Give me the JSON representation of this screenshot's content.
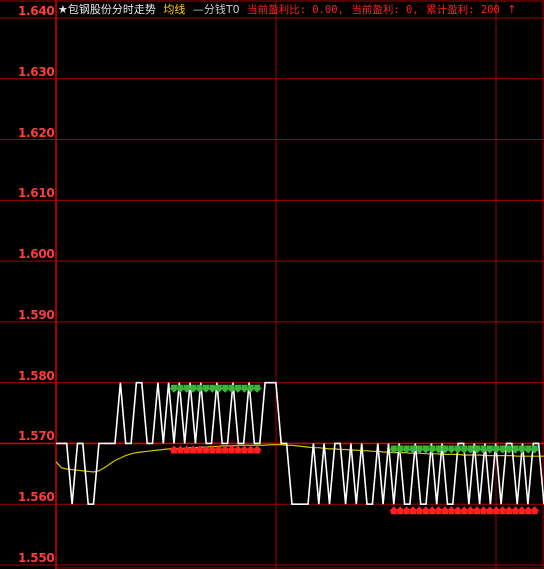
{
  "header": {
    "title": "★包钢股份分时走势",
    "avg_label": "均线",
    "minute_label": "—分钱T0",
    "profit_ratio_label": "当前盈利比",
    "profit_ratio_value": "0.00,",
    "current_profit_label": "当前盈利",
    "current_profit_value": "0,",
    "total_profit_label": "累计盈利",
    "total_profit_value": "200",
    "arrow": "↑"
  },
  "colors": {
    "background": "#000000",
    "grid": "#a00000",
    "axis_text": "#ff3c3c",
    "price_line": "#ffffff",
    "avg_line": "#d4c400",
    "buy_arrow": "#ff2020",
    "sell_arrow": "#3cb43c"
  },
  "chart_data": {
    "type": "line",
    "ylim": [
      1.55,
      1.64
    ],
    "yticks": [
      "1.640",
      "1.630",
      "1.620",
      "1.610",
      "1.600",
      "1.590",
      "1.580",
      "1.570",
      "1.560",
      "1.550"
    ],
    "series": [
      {
        "values": [
          1.57,
          1.57,
          1.57,
          1.56,
          1.57,
          1.57,
          1.56,
          1.56,
          1.57,
          1.57,
          1.57,
          1.57,
          1.58,
          1.57,
          1.57,
          1.58,
          1.58,
          1.57,
          1.57,
          1.58,
          1.57,
          1.58,
          1.57,
          1.58,
          1.57,
          1.58,
          1.57,
          1.58,
          1.57,
          1.57,
          1.58,
          1.57,
          1.57,
          1.58,
          1.57,
          1.57,
          1.58,
          1.57,
          1.57,
          1.58,
          1.58,
          1.58,
          1.57,
          1.57,
          1.56,
          1.56,
          1.56,
          1.56,
          1.57,
          1.56,
          1.57,
          1.56,
          1.57,
          1.57,
          1.56,
          1.57,
          1.56,
          1.57,
          1.56,
          1.56,
          1.57,
          1.56,
          1.57,
          1.56,
          1.57,
          1.56,
          1.56,
          1.57,
          1.56,
          1.56,
          1.57,
          1.56,
          1.57,
          1.56,
          1.56,
          1.57,
          1.57,
          1.56,
          1.57,
          1.56,
          1.57,
          1.56,
          1.57,
          1.56,
          1.57,
          1.57,
          1.56,
          1.57,
          1.56,
          1.57,
          1.57,
          1.56
        ]
      },
      {
        "values": [
          1.567,
          1.566,
          1.5658,
          1.5657,
          1.5656,
          1.5655,
          1.5654,
          1.5653,
          1.5655,
          1.566,
          1.5666,
          1.5672,
          1.5676,
          1.568,
          1.5683,
          1.5685,
          1.5686,
          1.5687,
          1.5688,
          1.5689,
          1.569,
          1.5691,
          1.5691,
          1.5692,
          1.5692,
          1.5693,
          1.5693,
          1.5694,
          1.5694,
          1.5695,
          1.5695,
          1.5696,
          1.5696,
          1.5696,
          1.5697,
          1.5697,
          1.5697,
          1.5697,
          1.5697,
          1.5697,
          1.5698,
          1.5698,
          1.5698,
          1.5697,
          1.5697,
          1.5696,
          1.5695,
          1.5694,
          1.5693,
          1.5693,
          1.5692,
          1.5691,
          1.5691,
          1.569,
          1.569,
          1.5689,
          1.5689,
          1.5688,
          1.5688,
          1.5687,
          1.5687,
          1.5686,
          1.5686,
          1.5685,
          1.5685,
          1.5685,
          1.5684,
          1.5684,
          1.5684,
          1.5683,
          1.5683,
          1.5683,
          1.5682,
          1.5682,
          1.5682,
          1.5682,
          1.5681,
          1.5681,
          1.5681,
          1.5681,
          1.568,
          1.568,
          1.568,
          1.568,
          1.568,
          1.568,
          1.5679,
          1.5679,
          1.5679,
          1.5679,
          1.5679,
          1.5679
        ]
      }
    ],
    "sell_markers": {
      "from_index": 22,
      "to_index": 38,
      "value": 1.579
    },
    "buy_markers_1": {
      "from_index": 22,
      "to_index": 38,
      "value": 1.569
    },
    "sell_markers_2": {
      "from_index": 63,
      "to_index": 90,
      "value": 1.569
    },
    "buy_markers_2": {
      "from_index": 63,
      "to_index": 90,
      "value": 1.559
    }
  }
}
